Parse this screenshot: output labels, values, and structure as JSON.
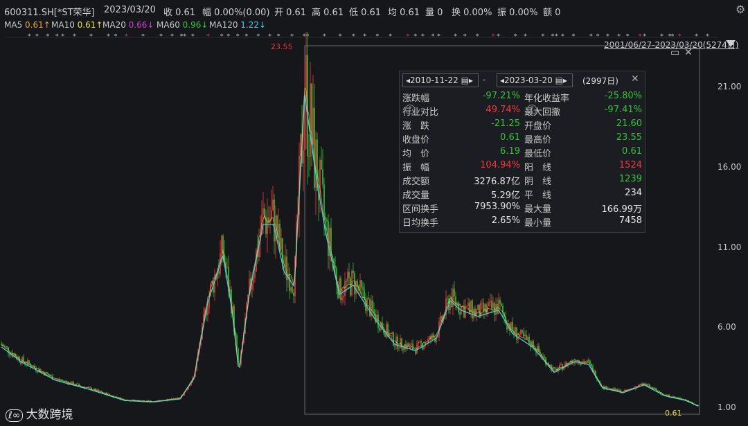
{
  "header": {
    "code": "600311.SH[*ST荣华]",
    "date": "2023/03/20",
    "close": "收 0.61",
    "change": "幅 0.00%(0.00)",
    "open": "开 0.61",
    "high": "高 0.61",
    "low": "低 0.61",
    "avg": "均 0.61",
    "volume": "量 0",
    "turnover": "换 0.00%",
    "amplitude": "振 0.00%",
    "amount": "额 0"
  },
  "ma": [
    {
      "label": "MA5",
      "value": "0.61↑",
      "color": "#e8a23c"
    },
    {
      "label": "MA10",
      "value": "0.61↑",
      "color": "#e8e03c"
    },
    {
      "label": "MA20",
      "value": "0.66↓",
      "color": "#d23cd2"
    },
    {
      "label": "MA60",
      "value": "0.96↓",
      "color": "#35c13a"
    },
    {
      "label": "MA120",
      "value": "1.22↓",
      "color": "#4bc8e6"
    }
  ],
  "range_label": "2001/06/27-2023/03/20(5274日)",
  "y_axis": [
    "21.00",
    "16.00",
    "11.00",
    "6.00",
    "1.00"
  ],
  "price_tags": {
    "max": "23.55",
    "last": "0.61"
  },
  "panel": {
    "start_date": "2010-11-22",
    "sep": "-",
    "end_date": "2023-03-20",
    "days": "(2997日)",
    "rows": [
      {
        "k1": "涨跌幅",
        "v1": "-97.21%",
        "c1": "green",
        "k2": "年化收益率",
        "v2": "-25.80%",
        "c2": "green"
      },
      {
        "k1": "行业对比",
        "v1": "49.74%",
        "c1": "red",
        "k2": "最大回撤",
        "v2": "-97.41%",
        "c2": "green"
      },
      {
        "k1": "涨　跌",
        "v1": "-21.25",
        "c1": "green",
        "k2": "开盘价",
        "v2": "21.60",
        "c2": "green"
      },
      {
        "k1": "收盘价",
        "v1": "0.61",
        "c1": "green",
        "k2": "最高价",
        "v2": "23.55",
        "c2": "green"
      },
      {
        "k1": "均　价",
        "v1": "6.19",
        "c1": "green",
        "k2": "最低价",
        "v2": "0.61",
        "c2": "green"
      },
      {
        "k1": "振　幅",
        "v1": "104.94%",
        "c1": "red",
        "k2": "阳　线",
        "v2": "1524",
        "c2": "red"
      },
      {
        "k1": "成交额",
        "v1": "3276.87亿",
        "c1": "wht",
        "k2": "阴　线",
        "v2": "1239",
        "c2": "green"
      },
      {
        "k1": "成交量",
        "v1": "5.29亿",
        "c1": "wht",
        "k2": "平　线",
        "v2": "234",
        "c2": "wht"
      },
      {
        "k1": "区间换手",
        "v1": "7953.90%",
        "c1": "wht",
        "k2": "最大量",
        "v2": "166.99万",
        "c2": "wht"
      },
      {
        "k1": "日均换手",
        "v1": "2.65%",
        "c1": "wht",
        "k2": "最小量",
        "v2": "7458",
        "c2": "wht"
      }
    ]
  },
  "logo": "大数跨境",
  "colors": {
    "up": "#ee3b3b",
    "down": "#35c13a",
    "ma_cyan": "#4bc8e6"
  },
  "series_anchors": [
    [
      0,
      4.7
    ],
    [
      30,
      3.7
    ],
    [
      80,
      2.5
    ],
    [
      130,
      1.9
    ],
    [
      180,
      1.2
    ],
    [
      220,
      1.1
    ],
    [
      260,
      1.3
    ],
    [
      280,
      2.6
    ],
    [
      300,
      7.5
    ],
    [
      322,
      10.5
    ],
    [
      335,
      7.0
    ],
    [
      345,
      3.0
    ],
    [
      360,
      8.0
    ],
    [
      380,
      12.5
    ],
    [
      395,
      12.5
    ],
    [
      410,
      9.5
    ],
    [
      425,
      8.5
    ],
    [
      440,
      20.8
    ],
    [
      455,
      16.0
    ],
    [
      470,
      12.0
    ],
    [
      490,
      8.0
    ],
    [
      510,
      8.6
    ],
    [
      540,
      6.5
    ],
    [
      570,
      4.8
    ],
    [
      600,
      4.4
    ],
    [
      630,
      5.2
    ],
    [
      650,
      7.6
    ],
    [
      665,
      7.0
    ],
    [
      690,
      6.6
    ],
    [
      720,
      7.0
    ],
    [
      740,
      5.5
    ],
    [
      770,
      4.6
    ],
    [
      800,
      3.0
    ],
    [
      830,
      3.7
    ],
    [
      850,
      3.5
    ],
    [
      870,
      2.0
    ],
    [
      900,
      1.7
    ],
    [
      930,
      2.2
    ],
    [
      960,
      1.5
    ],
    [
      990,
      1.2
    ],
    [
      1010,
      0.8
    ]
  ]
}
